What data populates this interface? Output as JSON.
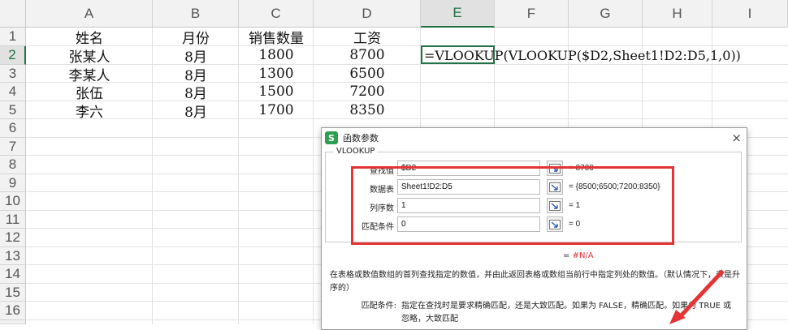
{
  "sheet": {
    "columns": [
      "A",
      "B",
      "C",
      "D",
      "E",
      "F",
      "G",
      "H",
      "I"
    ],
    "rows": [
      "1",
      "2",
      "3",
      "4",
      "5",
      "6",
      "7",
      "8",
      "9",
      "10",
      "11",
      "12",
      "13",
      "14",
      "15",
      "16",
      "17"
    ],
    "data": [
      [
        "姓名",
        "月份",
        "销售数量",
        "工资"
      ],
      [
        "张某人",
        "8月",
        "1800",
        "8700"
      ],
      [
        "李某人",
        "8月",
        "1300",
        "6500"
      ],
      [
        "张伍",
        "8月",
        "1500",
        "7200"
      ],
      [
        "李六",
        "8月",
        "1700",
        "8350"
      ]
    ],
    "active_formula": "=VLOOKUP(VLOOKUP($D2,Sheet1!D2:D5,1,0))",
    "accent": "#217346"
  },
  "dialog": {
    "title": "函数参数",
    "icon_letter": "S",
    "close_label": "×",
    "function_name": "VLOOKUP",
    "args": [
      {
        "label": "查找值",
        "value": "$D2",
        "result": "= 8700"
      },
      {
        "label": "数据表",
        "value": "Sheet1!D2:D5",
        "result": "= {8500;6500;7200;8350}"
      },
      {
        "label": "列序数",
        "value": "1",
        "result": "= 1"
      },
      {
        "label": "匹配条件",
        "value": "0",
        "result": "= 0"
      }
    ],
    "formula_result_prefix": "= ",
    "formula_result_value": "#N/A",
    "description": "在表格或数值数组的首列查找指定的数值，并由此返回表格或数组当前行中指定列处的数值。（默认情况下，表是升序的）",
    "param_name": "匹配条件:",
    "param_desc_line1": "指定在查找时是要求精确匹配，还是大致匹配。如果为 FALSE，精确匹配。如果为 TRUE 或",
    "param_desc_line2": "忽略，大致匹配",
    "highlight_color": "#e53434"
  }
}
